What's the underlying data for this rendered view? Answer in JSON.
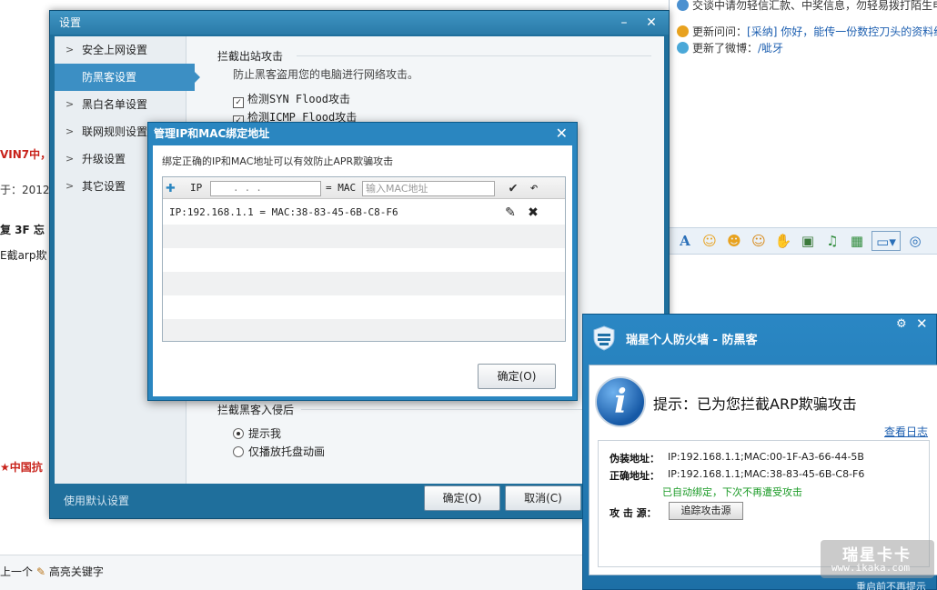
{
  "background": {
    "left_snippets": [
      "VIN7中，I",
      "于：2012-",
      "复 3F 忘",
      "E截arp欺",
      "★中国抗"
    ],
    "bottom_bar": [
      "上一个",
      "高亮关键字"
    ],
    "feed_top": "交谈中请勿轻信汇款、中奖信息，勿轻易拨打陌生电",
    "feed": [
      {
        "prefix": "更新问问：",
        "link": "[采纳]",
        "text": " 你好，能传一份数控刀头的资料给"
      },
      {
        "prefix": "更新了微博：",
        "link": "/呲牙",
        "text": ""
      }
    ]
  },
  "settings": {
    "title": "设置",
    "nav": [
      {
        "label": "安全上网设置",
        "active": false
      },
      {
        "label": "防黑客设置",
        "active": true
      },
      {
        "label": "黑白名单设置",
        "active": false
      },
      {
        "label": "联网规则设置",
        "active": false
      },
      {
        "label": "升级设置",
        "active": false
      },
      {
        "label": "其它设置",
        "active": false
      }
    ],
    "section1_title": "拦截出站攻击",
    "section1_desc": "防止黑客盗用您的电脑进行网络攻击。",
    "checkboxes": [
      {
        "label": "检测SYN Flood攻击",
        "checked": true
      },
      {
        "label": "检测ICMP Flood攻击",
        "checked": true
      }
    ],
    "section2_title": "拦截黑客入侵后",
    "radios": [
      {
        "label": "提示我",
        "selected": true
      },
      {
        "label": "仅播放托盘动画",
        "selected": false
      }
    ],
    "default_link": "使用默认设置",
    "ok_label": "确定(O)",
    "cancel_label": "取消(C)"
  },
  "ipmac": {
    "title": "管理IP和MAC绑定地址",
    "desc": "绑定正确的IP和MAC地址可以有效防止APR欺骗攻击",
    "ip_label": "IP",
    "ip_value": "...",
    "eq_mac_label": "= MAC",
    "mac_placeholder": "输入MAC地址",
    "rows": [
      "IP:192.168.1.1 = MAC:38-83-45-6B-C8-F6"
    ],
    "ok_label": "确定(O)"
  },
  "alert": {
    "title": "瑞星个人防火墙 - 防黑客",
    "headline": "提示：已为您拦截ARP欺骗攻击",
    "log_link": "查看日志",
    "fake_label": "伪装地址：",
    "fake_value": "IP:192.168.1.1;MAC:00-1F-A3-66-44-5B",
    "real_label": "正确地址：",
    "real_value": "IP:192.168.1.1;MAC:38-83-45-6B-C8-F6",
    "auto_bound": "已自动绑定，下次不再遭受攻击",
    "source_label": "攻 击 源：",
    "trace_label": "追踪攻击源",
    "watermark_main": "瑞星卡卡",
    "watermark_sub": "www.ikaka.com",
    "footer": "重启前不再提示"
  }
}
